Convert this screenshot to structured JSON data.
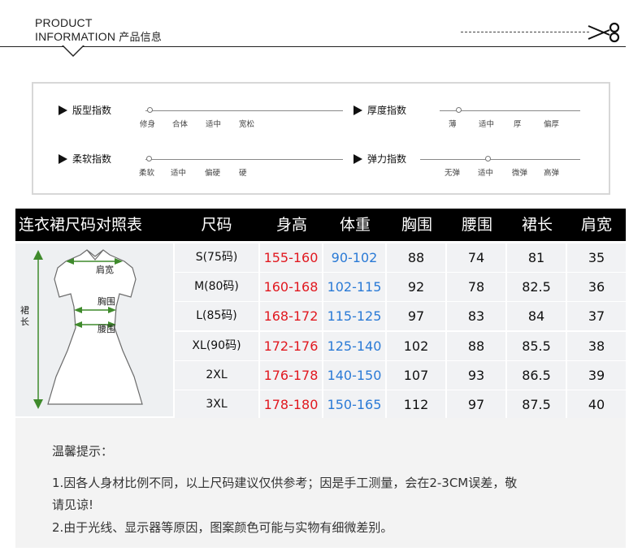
{
  "header": {
    "en_line1": "PRODUCT",
    "en_line2": "INFORMATION",
    "cn": "产品信息"
  },
  "indices": [
    {
      "label": "版型指数",
      "options": [
        "修身",
        "合体",
        "适中",
        "宽松"
      ],
      "selected": 0
    },
    {
      "label": "厚度指数",
      "options": [
        "薄",
        "适中",
        "厚",
        "偏厚"
      ],
      "selected": 0
    },
    {
      "label": "柔软指数",
      "options": [
        "柔软",
        "适中",
        "偏硬",
        "硬"
      ],
      "selected": 0
    },
    {
      "label": "弹力指数",
      "options": [
        "无弹",
        "适中",
        "微弹",
        "高弹"
      ],
      "selected": 1
    }
  ],
  "table": {
    "title": "连衣裙尺码对照表",
    "headers": [
      "尺码",
      "身高",
      "体重",
      "胸围",
      "腰围",
      "裙长",
      "肩宽"
    ],
    "rows": [
      [
        "S(75码)",
        "155-160",
        "90-102",
        "88",
        "74",
        "81",
        "35"
      ],
      [
        "M(80码)",
        "160-168",
        "102-115",
        "92",
        "78",
        "82.5",
        "36"
      ],
      [
        "L(85码)",
        "168-172",
        "115-125",
        "97",
        "83",
        "84",
        "37"
      ],
      [
        "XL(90码)",
        "172-176",
        "125-140",
        "102",
        "88",
        "85.5",
        "38"
      ],
      [
        "2XL",
        "176-178",
        "140-150",
        "107",
        "93",
        "86.5",
        "39"
      ],
      [
        "3XL",
        "178-180",
        "150-165",
        "112",
        "97",
        "87.5",
        "40"
      ]
    ]
  },
  "diagram": {
    "shoulder": "肩宽",
    "bust": "胸围",
    "waist": "腰围",
    "length": "裙长"
  },
  "tips": {
    "title": "温馨提示：",
    "line1": "1.因各人身材比例不同，以上尺码建议仅供参考；因是手工测量，会在2-3CM误差，敬",
    "line1b": "请见谅!",
    "line2": "2.由于光线、显示器等原因，图案颜色可能与实物有细微差别。"
  },
  "colors": {
    "red_text": "#e1181f",
    "blue_text": "#2a7ad6",
    "header_bg": "#000000",
    "arrow_green": "#3f8a2c"
  }
}
